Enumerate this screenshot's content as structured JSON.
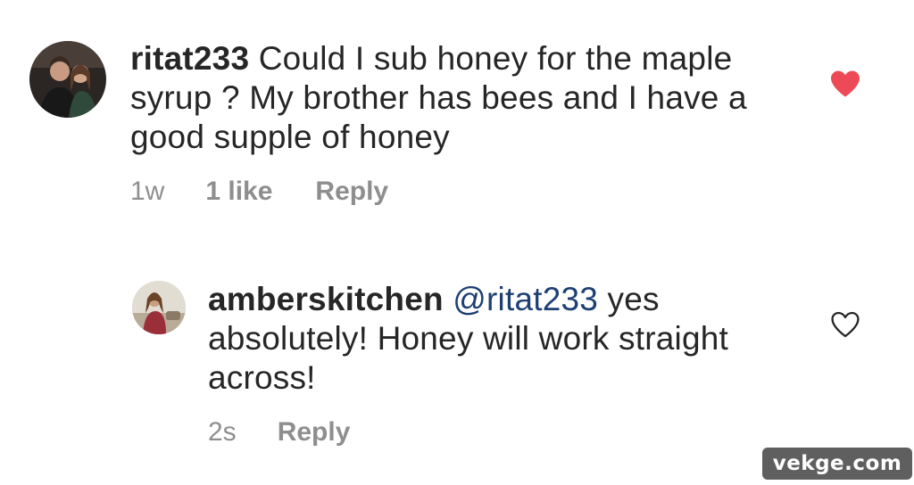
{
  "comments": [
    {
      "username": "ritat233",
      "text": "Could I sub honey for the maple syrup ? My brother has bees and I have a good supple of honey",
      "time": "1w",
      "likes": "1 like",
      "reply_label": "Reply",
      "liked": true,
      "heart_color": "#ed4956",
      "heart_icon": "heart-filled-icon"
    },
    {
      "username": "amberskitchen",
      "mention": "@ritat233",
      "text": "yes absolutely! Honey will work straight across!",
      "time": "2s",
      "reply_label": "Reply",
      "liked": false,
      "heart_icon": "heart-outline-icon"
    }
  ],
  "watermark": "vekge.com"
}
